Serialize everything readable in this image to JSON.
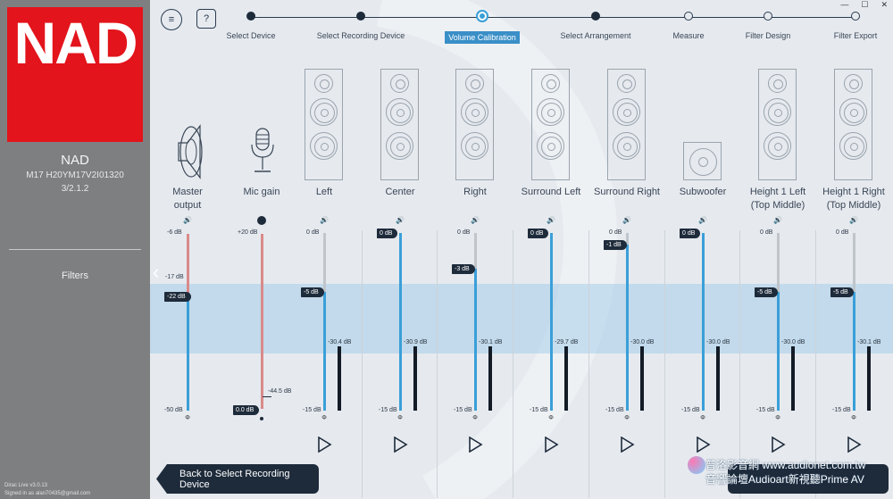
{
  "window": {
    "minimize": "—",
    "maximize": "☐",
    "close": "✕"
  },
  "sidebar": {
    "logo": "NAD",
    "device_name": "NAD",
    "device_model": "M17 H20YM17V2I01320",
    "device_config": "3/2.1.2",
    "filters_label": "Filters",
    "version": "Dirac Live v3.0.13",
    "signed_in": "Signed in as alan70435@gmail.com"
  },
  "toolbar": {
    "menu_icon": "≡",
    "help_label": "?"
  },
  "steps": [
    {
      "label": "Select Device",
      "state": "done"
    },
    {
      "label": "Select Recording Device",
      "state": "done"
    },
    {
      "label": "Volume Calibration",
      "state": "active"
    },
    {
      "label": "Select Arrangement",
      "state": "done"
    },
    {
      "label": "Measure",
      "state": "todo"
    },
    {
      "label": "Filter Design",
      "state": "todo"
    },
    {
      "label": "Filter Export",
      "state": "todo"
    }
  ],
  "master": {
    "name": "Master output",
    "top": "-6 dB",
    "bottom": "-50 dB",
    "target": "-17 dB",
    "value": "-22 dB",
    "phase": "Φ"
  },
  "mic": {
    "name": "Mic gain",
    "top": "+20 dB",
    "value": "0.0 dB",
    "level": "-44.5 dB"
  },
  "channels": [
    {
      "name": "Left",
      "top": "0 dB",
      "bottom": "-15 dB",
      "value": "-5 dB",
      "level": "-30.4 dB",
      "phase": "Φ"
    },
    {
      "name": "Center",
      "top": "0 dB",
      "bottom": "-15 dB",
      "value": "0 dB",
      "level": "-30.9 dB",
      "phase": "Φ"
    },
    {
      "name": "Right",
      "top": "0 dB",
      "bottom": "-15 dB",
      "value": "-3 dB",
      "level": "-30.1 dB",
      "phase": "Φ"
    },
    {
      "name": "Surround Left",
      "top": "0 dB",
      "bottom": "-15 dB",
      "value": "0 dB",
      "level": "-29.7 dB",
      "phase": "Φ"
    },
    {
      "name": "Surround Right",
      "top": "0 dB",
      "bottom": "-15 dB",
      "value": "-1 dB",
      "level": "-30.0 dB",
      "phase": "Φ"
    },
    {
      "name": "Subwoofer",
      "top": "0 dB",
      "bottom": "-15 dB",
      "value": "0 dB",
      "level": "-30.0 dB",
      "phase": "Φ"
    },
    {
      "name": "Height 1 Left\n(Top Middle)",
      "top": "0 dB",
      "bottom": "-15 dB",
      "value": "-5 dB",
      "level": "-30.0 dB",
      "phase": "Φ"
    },
    {
      "name": "Height 1 Right\n(Top Middle)",
      "top": "0 dB",
      "bottom": "-15 dB",
      "value": "-5 dB",
      "level": "-30.1 dB",
      "phase": "Φ"
    }
  ],
  "footer": {
    "back_label": "Back to Select Recording Device",
    "watermark_line1": "普洛影音網 www.audionet.com.tw",
    "watermark_line2": "音響論壇Audioart新視聽Prime AV"
  },
  "colors": {
    "brand": "#e3141b",
    "accent": "#3a9fd8",
    "dark": "#1e2b3b"
  }
}
